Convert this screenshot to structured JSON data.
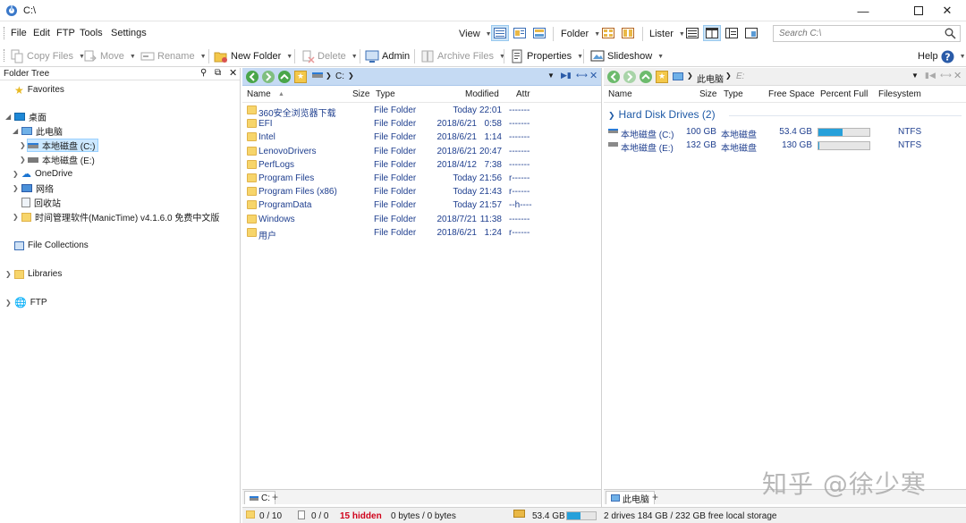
{
  "window": {
    "title": "C:\\"
  },
  "menu": [
    "File",
    "Edit",
    "FTP",
    "Tools",
    "Settings"
  ],
  "toolbar_top": {
    "view": "View",
    "folder": "Folder",
    "lister": "Lister",
    "search_placeholder": "Search C:\\"
  },
  "toolbar": {
    "copy": "Copy Files",
    "move": "Move",
    "rename": "Rename",
    "new_folder": "New Folder",
    "delete": "Delete",
    "admin": "Admin",
    "archive": "Archive Files",
    "properties": "Properties",
    "slideshow": "Slideshow",
    "help": "Help"
  },
  "tree": {
    "header": "Folder Tree",
    "favorites": "Favorites",
    "desktop": "桌面",
    "this_pc": "此电脑",
    "drive_c": "本地磁盘 (C:)",
    "drive_e": "本地磁盘 (E:)",
    "onedrive": "OneDrive",
    "network": "网络",
    "recycle": "回收站",
    "manictime": "时间管理软件(ManicTime) v4.1.6.0 免费中文版",
    "collections": "File Collections",
    "libraries": "Libraries",
    "ftp": "FTP"
  },
  "left": {
    "path": "C:",
    "columns": [
      "Name",
      "Size",
      "Type",
      "Modified",
      "Attr"
    ],
    "rows": [
      {
        "name": "360安全浏览器下载",
        "type": "File Folder",
        "date": "Today",
        "time": "22:01",
        "attr": "-------"
      },
      {
        "name": "EFI",
        "type": "File Folder",
        "date": "2018/6/21",
        "time": "0:58",
        "attr": "-------"
      },
      {
        "name": "Intel",
        "type": "File Folder",
        "date": "2018/6/21",
        "time": "1:14",
        "attr": "-------"
      },
      {
        "name": "LenovoDrivers",
        "type": "File Folder",
        "date": "2018/6/21",
        "time": "20:47",
        "attr": "-------"
      },
      {
        "name": "PerfLogs",
        "type": "File Folder",
        "date": "2018/4/12",
        "time": "7:38",
        "attr": "-------"
      },
      {
        "name": "Program Files",
        "type": "File Folder",
        "date": "Today",
        "time": "21:56",
        "attr": "r------"
      },
      {
        "name": "Program Files (x86)",
        "type": "File Folder",
        "date": "Today",
        "time": "21:43",
        "attr": "r------"
      },
      {
        "name": "ProgramData",
        "type": "File Folder",
        "date": "Today",
        "time": "21:57",
        "attr": "--h----"
      },
      {
        "name": "Windows",
        "type": "File Folder",
        "date": "2018/7/21",
        "time": "11:38",
        "attr": "-------"
      },
      {
        "name": "用户",
        "type": "File Folder",
        "date": "2018/6/21",
        "time": "1:24",
        "attr": "r------"
      }
    ],
    "tab": "C:"
  },
  "right": {
    "path_main": "此电脑",
    "path_next": "E:",
    "columns": [
      "Name",
      "Size",
      "Type",
      "Free Space",
      "Percent Full",
      "Filesystem"
    ],
    "group": "Hard Disk Drives (2)",
    "drives": [
      {
        "name": "本地磁盘 (C:)",
        "size": "100 GB",
        "type": "本地磁盘",
        "free": "53.4 GB",
        "percent_full": 0.47,
        "fs": "NTFS"
      },
      {
        "name": "本地磁盘 (E:)",
        "size": "132 GB",
        "type": "本地磁盘",
        "free": "130 GB",
        "percent_full": 0.02,
        "fs": "NTFS"
      }
    ],
    "tab": "此电脑"
  },
  "status": {
    "folders": "0 / 10",
    "files": "0 / 0",
    "hidden": "15 hidden",
    "bytes": "0 bytes / 0 bytes",
    "free": "53.4 GB",
    "free_percent_full": 0.47,
    "right": "2 drives  184 GB / 232 GB free local storage"
  },
  "watermark": "知乎 @徐少寒",
  "colors": {
    "accent": "#26a0da",
    "hidden": "#d0021b",
    "link": "#1f3f8f"
  }
}
